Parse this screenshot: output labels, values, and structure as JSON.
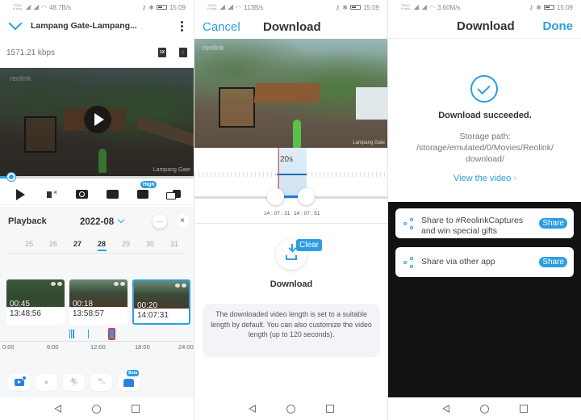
{
  "status_bars": [
    {
      "carrier": "TRUE-H dtac",
      "net_speed": "48.7B/s",
      "time": "15:09"
    },
    {
      "carrier": "TRUE-H dtac",
      "net_speed": "113B/s",
      "time": "15:09"
    },
    {
      "carrier": "TRUE-H dtac",
      "net_speed": "3.60M/s",
      "time": "15:09"
    }
  ],
  "screen1": {
    "title": "Lampang Gate-Lampang...",
    "bitrate": "1571.21 kbps",
    "speed_btn": "1X",
    "video": {
      "brand_watermark": "reolink",
      "camera_label": "Lampang Gate",
      "progress": 0.06
    },
    "controls": {
      "quality_badge": "High"
    },
    "playback": {
      "title": "Playback",
      "month": "2022-08",
      "more_label": "···",
      "close_label": "×",
      "days": [
        {
          "label": "25",
          "style": "dim"
        },
        {
          "label": "26",
          "style": "dim"
        },
        {
          "label": "27",
          "style": "bold"
        },
        {
          "label": "28",
          "style": "sel"
        },
        {
          "label": "29",
          "style": "dim"
        },
        {
          "label": "30",
          "style": "dim"
        },
        {
          "label": "31",
          "style": "dim"
        }
      ],
      "clips": [
        {
          "duration": "00:45",
          "time": "13:48:56"
        },
        {
          "duration": "00:18",
          "time": "13:58:57"
        },
        {
          "duration": "00:20",
          "time": "14:07:31"
        }
      ],
      "timeline_ticks": [
        "0:00",
        "6:00",
        "12:00",
        "18:00",
        "24:00"
      ],
      "timeline_events_hours": [
        8.4,
        8.6,
        8.9,
        10.9,
        14.1
      ]
    },
    "tools": {
      "beta_badge": "Beta"
    }
  },
  "screen2": {
    "cancel": "Cancel",
    "title": "Download",
    "video": {
      "brand_watermark": "reolink",
      "camera_label": "Lampang Gate"
    },
    "selection_length": "20s",
    "start_time": "14 : 07 : 31",
    "end_time": "14 : 07 : 51",
    "clear": "Clear",
    "download_label": "Download",
    "info": "The downloaded video length is set to a suitable length by default. You can also customize the video length (up to 120 seconds)."
  },
  "screen3": {
    "title": "Download",
    "done": "Done",
    "success": "Download succeeded.",
    "path_label": "Storage path:",
    "path_line1": "/storage/emulated/0/Movies/Reolink/",
    "path_line2": "download/",
    "view_video": "View the video",
    "share_items": [
      {
        "text": "Share to #ReolinkCaptures and win special gifts",
        "button": "Share"
      },
      {
        "text": "Share via other app",
        "button": "Share"
      }
    ]
  },
  "colors": {
    "accent": "#2c9de0",
    "marker_red": "#e23a3a",
    "dark_sheet": "#121212"
  }
}
